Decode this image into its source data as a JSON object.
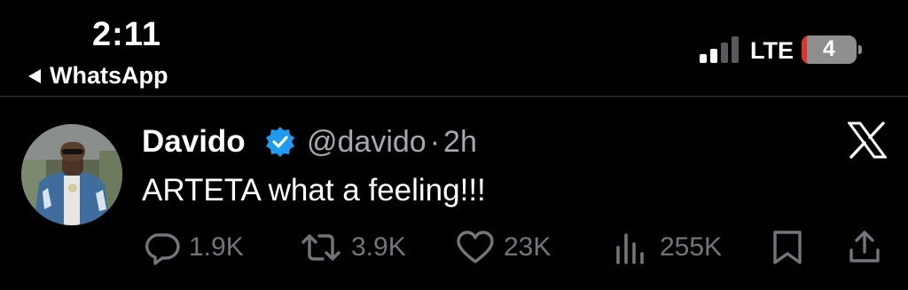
{
  "status_bar": {
    "time": "2:11",
    "back_app": "WhatsApp",
    "network": "LTE",
    "battery": "4",
    "colors": {
      "battery_low": "#e0342a",
      "battery_body": "#8e8e8e"
    }
  },
  "tweet": {
    "author_name": "Davido",
    "verified": true,
    "handle": "@davido",
    "separator": "·",
    "time_ago": "2h",
    "text": "ARTETA what a feeling!!!",
    "platform_icon": "x-logo-icon",
    "colors": {
      "verified_badge": "#1d9bf0",
      "secondary_text": "#a6aab0",
      "action_icon": "#71767b"
    }
  },
  "actions": {
    "replies": {
      "icon": "reply-icon",
      "count": "1.9K"
    },
    "reposts": {
      "icon": "repost-icon",
      "count": "3.9K"
    },
    "likes": {
      "icon": "heart-icon",
      "count": "23K"
    },
    "views": {
      "icon": "views-icon",
      "count": "255K"
    },
    "bookmark": {
      "icon": "bookmark-icon"
    },
    "share": {
      "icon": "share-icon"
    }
  }
}
